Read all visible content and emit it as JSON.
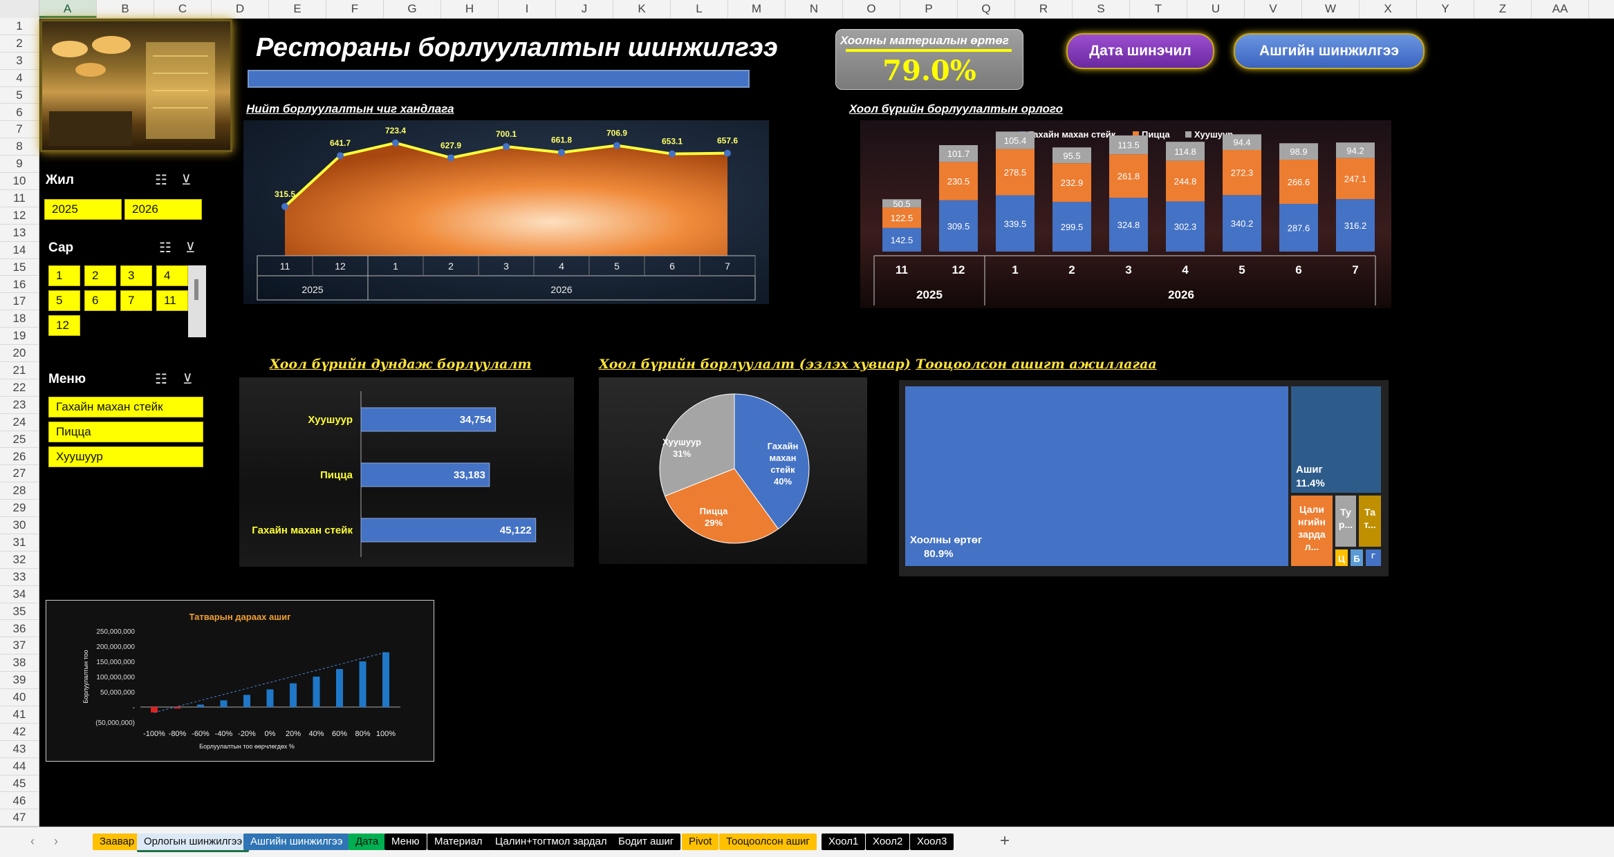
{
  "columns": [
    "A",
    "B",
    "C",
    "D",
    "E",
    "F",
    "G",
    "H",
    "I",
    "J",
    "K",
    "L",
    "M",
    "N",
    "O",
    "P",
    "Q",
    "R",
    "S",
    "T",
    "U",
    "V",
    "W",
    "X",
    "Y",
    "Z",
    "AA"
  ],
  "rows": [
    "1",
    "2",
    "3",
    "4",
    "5",
    "6",
    "7",
    "8",
    "9",
    "10",
    "11",
    "12",
    "13",
    "14",
    "15",
    "16",
    "17",
    "18",
    "19",
    "20",
    "21",
    "22",
    "23",
    "24",
    "25",
    "26",
    "27",
    "28",
    "29",
    "30",
    "31",
    "32",
    "33",
    "34",
    "35",
    "36",
    "37",
    "38",
    "39",
    "40",
    "41",
    "42",
    "43",
    "44",
    "45",
    "46",
    "47"
  ],
  "dashboard": {
    "title": "Рестораны борлуулалтын шинжилгээ",
    "kpi": {
      "label": "Хоолны материалын өртөг",
      "value": "79.0%"
    },
    "buttons": {
      "data_analysis": "Дата шинэчил",
      "profit_analysis": "Ашгийн шинжилгээ"
    }
  },
  "slicers": {
    "year": {
      "title": "Жил",
      "items": [
        "2025",
        "2026"
      ]
    },
    "month": {
      "title": "Сар",
      "items": [
        "1",
        "2",
        "3",
        "4",
        "5",
        "6",
        "7",
        "11",
        "12"
      ]
    },
    "menu": {
      "title": "Меню",
      "items": [
        "Гахайн махан стейк",
        "Пицца",
        "Хуушуур"
      ]
    }
  },
  "sections": {
    "trend": "Нийт борлуулалтын чиг хандлага",
    "revenue_by_dish": "Хоол бүрийн борлуулалтын орлого",
    "avg_sales": "Хоол бүрийн дундаж борлуулалт",
    "share": "Хоол бүрийн борлуулалт (эзлэх хувиар)",
    "profit": "Тооцоолсон ашигт ажиллагаа"
  },
  "chart_data": [
    {
      "type": "area",
      "categories": [
        "11",
        "12",
        "1",
        "2",
        "3",
        "4",
        "5",
        "6",
        "7"
      ],
      "groups": [
        {
          "label": "2025",
          "span": 2
        },
        {
          "label": "2026",
          "span": 7
        }
      ],
      "values": [
        315.5,
        641.7,
        723.4,
        627.9,
        700.1,
        661.8,
        706.9,
        653.1,
        657.6
      ],
      "labels": [
        "315.5",
        "641.7",
        "723.4",
        "627.9",
        "700.1",
        "661.8",
        "706.9",
        "653.1",
        "657.6"
      ]
    },
    {
      "type": "bar",
      "stacked": true,
      "categories": [
        "11",
        "12",
        "1",
        "2",
        "3",
        "4",
        "5",
        "6",
        "7"
      ],
      "groups": [
        {
          "label": "2025",
          "span": 2
        },
        {
          "label": "2026",
          "span": 7
        }
      ],
      "series": [
        {
          "name": "Гахайн махан стейк",
          "color": "#4472c4",
          "values": [
            142.5,
            309.5,
            339.5,
            299.5,
            324.8,
            302.3,
            340.2,
            287.6,
            316.2
          ]
        },
        {
          "name": "Пицца",
          "color": "#ed7d31",
          "values": [
            122.5,
            230.5,
            278.5,
            232.9,
            261.8,
            244.8,
            272.3,
            266.6,
            247.1
          ]
        },
        {
          "name": "Хуушуур",
          "color": "#a5a5a5",
          "values": [
            50.5,
            101.7,
            105.4,
            95.5,
            113.5,
            114.8,
            94.4,
            98.9,
            94.2
          ]
        }
      ],
      "legend": "top"
    },
    {
      "type": "bar",
      "orientation": "horizontal",
      "categories": [
        "Хуушуур",
        "Пицца",
        "Гахайн махан стейк"
      ],
      "values": [
        34754,
        33183,
        45122
      ],
      "labels": [
        "34,754",
        "33,183",
        "45,122"
      ]
    },
    {
      "type": "pie",
      "slices": [
        {
          "label": "Гахайн махан стейк",
          "pct": "40%",
          "value": 40,
          "color": "#4472c4"
        },
        {
          "label": "Пицца",
          "pct": "29%",
          "value": 29,
          "color": "#ed7d31"
        },
        {
          "label": "Хуушуур",
          "pct": "31%",
          "value": 31,
          "color": "#a5a5a5"
        }
      ]
    },
    {
      "type": "treemap",
      "items": [
        {
          "label": "Хоолны өртөг",
          "pct": "80.9%",
          "value": 80.9,
          "color": "#4472c4"
        },
        {
          "label": "Ашиг",
          "pct": "11.4%",
          "value": 11.4,
          "color": "#2e5c8a"
        },
        {
          "label": "Цалингийн зардал",
          "short": "Цали нгийн зарда л...",
          "value": 3.5,
          "color": "#ed7d31"
        },
        {
          "label": "Тр...",
          "short": "Ту р...",
          "value": 1.5,
          "color": "#a5a5a5"
        },
        {
          "label": "Та т...",
          "short": "Та т...",
          "value": 1.5,
          "color": "#bf8f00"
        },
        {
          "label": "Ц",
          "short": "Ц",
          "value": 0.5,
          "color": "#ffc000"
        },
        {
          "label": "Б",
          "short": "Б",
          "value": 0.4,
          "color": "#5b9bd5"
        },
        {
          "label": "Г",
          "short": "Г",
          "value": 0.3,
          "color": "#4472c4"
        }
      ]
    },
    {
      "type": "bar",
      "title": "Татварын дараах ашиг",
      "xlabel": "Борлуулалтын тоо өөрчлөгдөх %",
      "ylabel": "Борлуулалтын тоо",
      "categories": [
        "-100%",
        "-80%",
        "-60%",
        "-40%",
        "-20%",
        "0%",
        "20%",
        "40%",
        "60%",
        "80%",
        "100%"
      ],
      "values": [
        -18000000,
        -5000000,
        8000000,
        22000000,
        40000000,
        58000000,
        78000000,
        100000000,
        125000000,
        150000000,
        180000000
      ],
      "yticks": [
        "250,000,000",
        "200,000,000",
        "150,000,000",
        "100,000,000",
        "50,000,000",
        "-",
        "(50,000,000)"
      ],
      "ylim": [
        -50000000,
        250000000
      ]
    }
  ],
  "tabs": [
    {
      "label": "Заавар",
      "bg": "#ffc000",
      "fg": "#111"
    },
    {
      "label": "Орлогын шинжилгээ",
      "bg": "#dbe9f6",
      "fg": "#111",
      "active": true
    },
    {
      "label": "Ашгийн шинжилгээ",
      "bg": "#2f75b5",
      "fg": "#fff"
    },
    {
      "label": "Дата",
      "bg": "#00b050",
      "fg": "#111"
    },
    {
      "label": "Меню",
      "bg": "#000",
      "fg": "#fff"
    },
    {
      "label": "Материал",
      "bg": "#000",
      "fg": "#fff"
    },
    {
      "label": "Цалин+тогтмол зардал",
      "bg": "#000",
      "fg": "#fff"
    },
    {
      "label": "Бодит ашиг",
      "bg": "#000",
      "fg": "#fff"
    },
    {
      "label": "Pivot",
      "bg": "#ffc000",
      "fg": "#111"
    },
    {
      "label": "Тооцоолсон ашиг",
      "bg": "#ffc000",
      "fg": "#111"
    },
    {
      "label": "Хоол1",
      "bg": "#000",
      "fg": "#fff"
    },
    {
      "label": "Хоол2",
      "bg": "#000",
      "fg": "#fff"
    },
    {
      "label": "Хоол3",
      "bg": "#000",
      "fg": "#fff"
    }
  ],
  "tabnav": {
    "add": "+"
  }
}
